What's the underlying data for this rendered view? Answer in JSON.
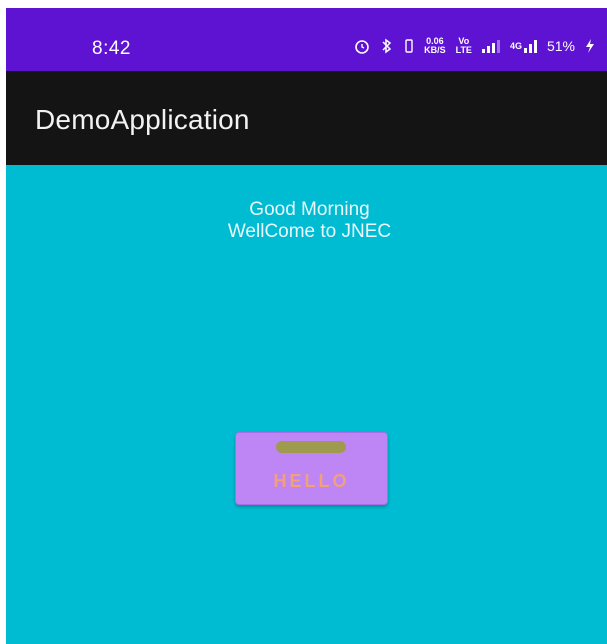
{
  "status_bar": {
    "time": "8:42",
    "speed": "0.06",
    "speed_unit": "KB/S",
    "volte_top": "Vo",
    "volte_bottom": "LTE",
    "network": "4G",
    "battery": "51%",
    "background_color": "#5f13d2"
  },
  "app_bar": {
    "title": "DemoApplication",
    "background_color": "#141414"
  },
  "content": {
    "background_color": "#00bcd3",
    "greeting_line1": "Good Morning",
    "greeting_line2": "WellCome to JNEC",
    "button": {
      "label": "HELLO",
      "background_color": "#bd86f4",
      "label_color": "#f1a078"
    }
  }
}
